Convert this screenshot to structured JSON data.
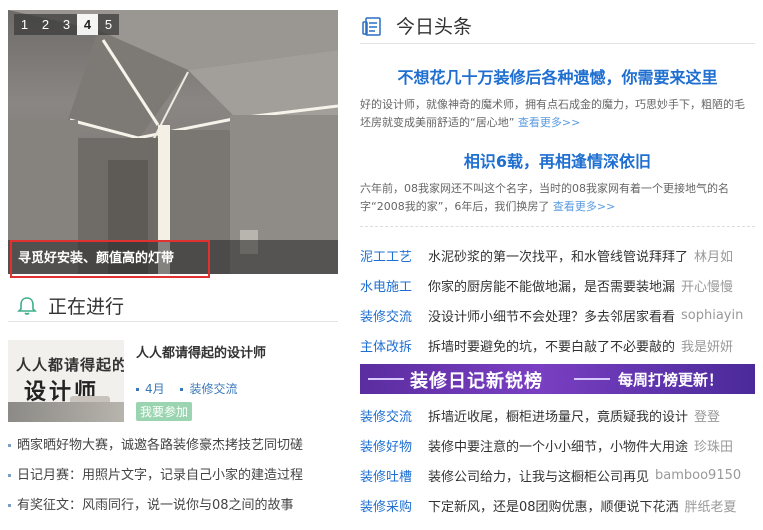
{
  "slider": {
    "pages": [
      "1",
      "2",
      "3",
      "4",
      "5"
    ],
    "active_page": "4",
    "caption": "寻觅好安装、颜值高的灯带"
  },
  "ongoing": {
    "title": "正在进行",
    "feature": {
      "thumb_line1": "人人都请得起的",
      "thumb_line2": "设计师",
      "title": "人人都请得起的设计师",
      "month": "4月",
      "category": "装修交流",
      "join_label": "我要参加"
    },
    "items": [
      "晒家晒好物大赛，诚邀各路装修豪杰拷技艺同切磋",
      "日记月赛：用照片文字，记录自己小家的建造过程",
      "有奖征文：风雨同行，说一说你与08之间的故事"
    ]
  },
  "headlines": {
    "title": "今日头条",
    "story1": {
      "headline": "不想花几十万装修后各种遗憾，你需要来这里",
      "body": "好的设计师，就像神奇的魔术师，拥有点石成金的魔力，巧思妙手下，粗陋的毛坯房就变成美丽舒适的“居心地”",
      "more": "查看更多>>"
    },
    "story2": {
      "headline": "相识6载，再相逢情深依旧",
      "body": "六年前，08我家网还不叫这个名字，当时的08我家网有着一个更接地气的名字“2008我的家”，6年后，我们换房了",
      "more": "查看更多>>"
    },
    "rows_a": [
      {
        "cat": "泥工工艺",
        "text": "水泥砂浆的第一次找平，和水管线管说拜拜了",
        "author": "林月如"
      },
      {
        "cat": "水电施工",
        "text": "你家的厨房能不能做地漏，是否需要装地漏",
        "author": "开心慢慢"
      },
      {
        "cat": "装修交流",
        "text": "没设计师小细节不会处理？多去邻居家看看",
        "author": "sophiayin"
      },
      {
        "cat": "主体改拆",
        "text": "拆墙时要避免的坑，不要白敲了不必要敲的",
        "author": "我是妍妍"
      }
    ],
    "banner": {
      "left": "装修日记新锐榜",
      "right": "每周打榜更新！"
    },
    "rows_b": [
      {
        "cat": "装修交流",
        "text": "拆墙近收尾，橱柜进场量尺，竟质疑我的设计",
        "author": "登登"
      },
      {
        "cat": "装修好物",
        "text": "装修中要注意的一个小小细节，小物件大用途",
        "author": "珍珠田"
      },
      {
        "cat": "装修吐槽",
        "text": "装修公司给力，让我与这橱柜公司再见",
        "author": "bamboo9150"
      },
      {
        "cat": "装修采购",
        "text": "下定新风，还是08团购优惠，顺便说下花洒",
        "author": "胖纸老夏"
      }
    ]
  },
  "colors": {
    "link_blue": "#1f6fd1",
    "highlight_red": "#e03030",
    "badge_green": "#9bd4b0",
    "banner_purple": "#5b2da0"
  }
}
